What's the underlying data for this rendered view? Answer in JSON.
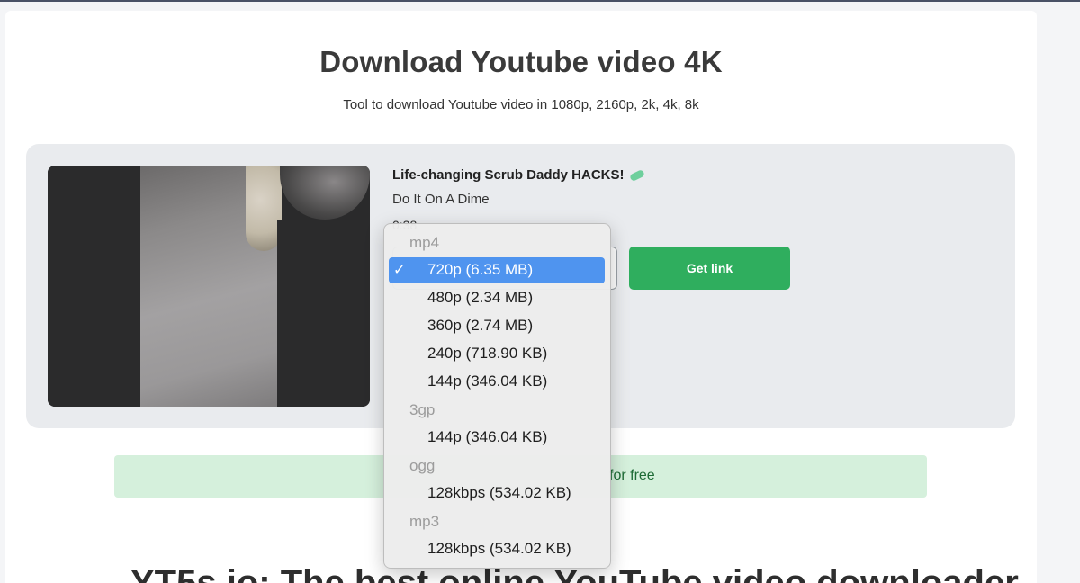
{
  "page": {
    "title": "Download Youtube video 4K",
    "subtitle": "Tool to download Youtube video in 1080p, 2160p, 2k, 4k, 8k"
  },
  "video": {
    "title": "Life-changing Scrub Daddy HACKS!",
    "channel": "Do It On A Dime",
    "duration": "0:38"
  },
  "actions": {
    "get_link_label": "Get link"
  },
  "promo": {
    "visible_text": "for free"
  },
  "bottom_heading": "YT5s.io: The best online YouTube video downloader",
  "dropdown": {
    "selected_value": "720p (6.35 MB)",
    "check_mark": "✓",
    "groups": [
      {
        "label": "mp4",
        "options": [
          "720p (6.35 MB)",
          "480p (2.34 MB)",
          "360p (2.74 MB)",
          "240p (718.90 KB)",
          "144p (346.04 KB)"
        ]
      },
      {
        "label": "3gp",
        "options": [
          "144p (346.04 KB)"
        ]
      },
      {
        "label": "ogg",
        "options": [
          "128kbps (534.02 KB)"
        ]
      },
      {
        "label": "mp3",
        "options": [
          "128kbps (534.02 KB)"
        ]
      }
    ]
  },
  "colors": {
    "accent_green": "#2fae5e",
    "selection_blue": "#4f94ef",
    "promo_bg": "#d5f0dc"
  }
}
